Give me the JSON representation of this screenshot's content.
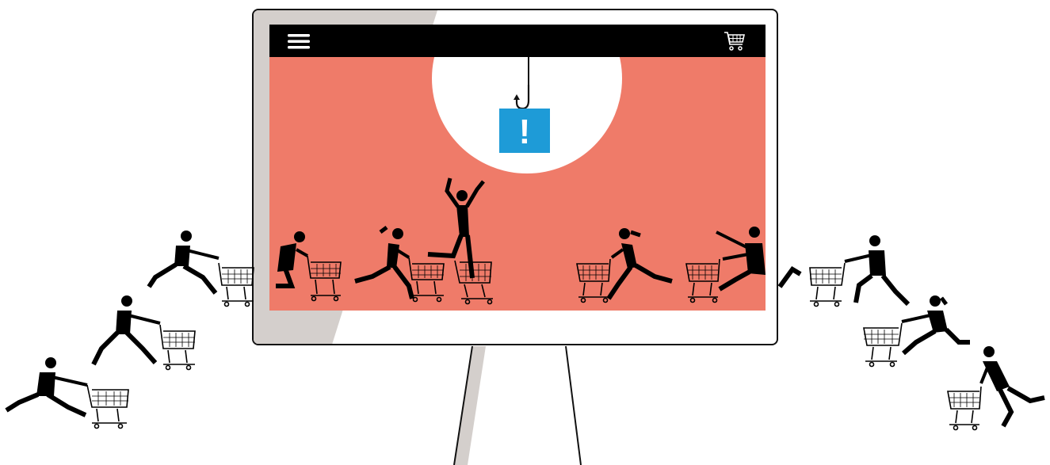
{
  "colors": {
    "screen_background": "#ef7b69",
    "topbar": "#000000",
    "frame_shadow": "#d4cfcc",
    "alert_box": "#1e9bd7",
    "figures": "#000000"
  },
  "header": {
    "menu_icon": "hamburger-menu-icon",
    "cart_icon": "shopping-cart-icon"
  },
  "bait": {
    "icon": "fish-hook-icon",
    "sign_text": "!"
  }
}
